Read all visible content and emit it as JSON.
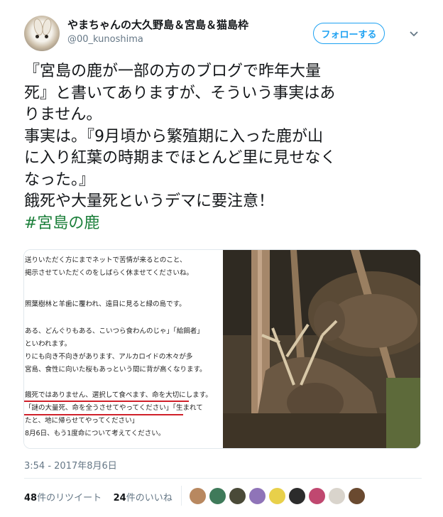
{
  "user": {
    "name": "やまちゃんの大久野島＆宮島＆猫島枠",
    "handle": "@00_kunoshima",
    "follow_label": "フォローする"
  },
  "tweet": {
    "lines": [
      "『宮島の鹿が一部の方のブログで昨年大量",
      "死』と書いてありますが、そういう事実はあ",
      "りません。",
      "事実は。『9月頃から繁殖期に入った鹿が山",
      "に入り紅葉の時期までほとんど里に見せなく",
      "なった。』",
      "餓死や大量死というデマに要注意！"
    ],
    "hashtag": "#宮島の鹿"
  },
  "blog_lines": [
    "送りいただく方にまでネットで苦情が来るとのこと、",
    "掲示させていただくのをしばらく休ませてくださいね。",
    "",
    "照葉樹林と羊歯に覆われ、遠目に見ると緑の島です。",
    "",
    "ある、どんぐりもある、こいつら食わんのじゃ」「給餌者」",
    "といわれます。",
    "りにも向き不向きがあります、アルカロイドの木々が多",
    "宮島、食性に向いた桜もあっという間に背が高くなります。",
    "",
    "餓死ではありません、選択して食べます、命を大切にします。",
    "「謎の大量死、命を全うさせてやってください」「生まれて",
    "たと、地に帰らせてやってください」",
    "8月6日、もう1度命について考えてください。"
  ],
  "timestamp": "3:54 - 2017年8月6日",
  "stats": {
    "retweets_count": "48",
    "retweets_label": "件のリツイート",
    "likes_count": "24",
    "likes_label": "件のいいね"
  },
  "colors": {
    "accent": "#1da1f2",
    "hashtag": "#1b7f3a",
    "underline": "#d0202a"
  }
}
